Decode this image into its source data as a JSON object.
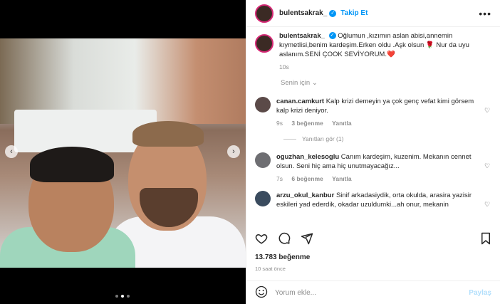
{
  "post": {
    "username": "bulentsakrak_",
    "follow_label": "Takip Et",
    "more_label": "•••",
    "caption": "Oğlumun ,kızımın aslan abisi,annemin kıymetlisi,benim kardeşim.Erken oldu .Aşk olsun 🌹 Nur da uyu aslanım.SENİ ÇOOK SEVİYORUM.❤️",
    "caption_time": "10s",
    "for_you_label": "Senin için ⌄",
    "likes": "13.783 beğenme",
    "posted": "10 saat önce"
  },
  "comments": [
    {
      "username": "canan.camkurt",
      "text": "Kalp krizi demeyin ya çok genç vefat kimi görsem kalp krizi deniyor.",
      "time": "9s",
      "likes": "3 beğenme",
      "reply": "Yanıtla",
      "avatar_color": "#5b4a48"
    },
    {
      "username": "oguzhan_kelesoglu",
      "text": "Canım kardeşim, kuzenim. Mekanın cennet olsun. Seni hiç ama hiç unutmayacağız...",
      "time": "7s",
      "likes": "6 beğenme",
      "reply": "Yanıtla",
      "avatar_color": "#6e6e72"
    },
    {
      "username": "arzu_okul_kanbur",
      "text": "Sinif arkadasiydik, orta okulda, arasira yazisir eskileri yad ederdik, okadar uzuldumki...ah onur, mekanin",
      "avatar_color": "#3a4b5e"
    }
  ],
  "replies_label": "Yanıtları gör (1)",
  "composer": {
    "placeholder": "Yorum ekle...",
    "post_label": "Paylaş"
  },
  "carousel": {
    "prev": "‹",
    "next": "›"
  },
  "icons": {
    "like": "heart-icon",
    "comment": "comment-icon",
    "share": "share-icon",
    "save": "bookmark-icon",
    "emoji": "emoji-icon",
    "verified": "verified-badge-icon"
  },
  "colors": {
    "accent": "#0095f6",
    "muted": "#8e8e8e",
    "post_disabled": "#b2dffc"
  }
}
